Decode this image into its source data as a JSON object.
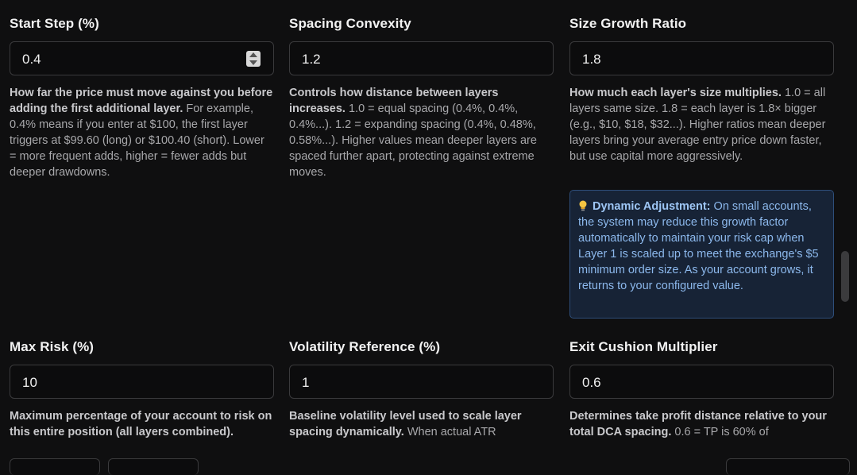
{
  "fields": [
    {
      "label": "Start Step (%)",
      "value": "0.4",
      "desc_bold": "How far the price must move against you before adding the first additional layer.",
      "desc_rest": " For example, 0.4% means if you enter at $100, the first layer triggers at $99.60 (long) or $100.40 (short). Lower = more frequent adds, higher = fewer adds but deeper drawdowns."
    },
    {
      "label": "Spacing Convexity",
      "value": "1.2",
      "desc_bold": "Controls how distance between layers increases.",
      "desc_rest": " 1.0 = equal spacing (0.4%, 0.4%, 0.4%...). 1.2 = expanding spacing (0.4%, 0.48%, 0.58%...). Higher values mean deeper layers are spaced further apart, protecting against extreme moves."
    },
    {
      "label": "Size Growth Ratio",
      "value": "1.8",
      "desc_bold": "How much each layer's size multiplies.",
      "desc_rest": " 1.0 = all layers same size. 1.8 = each layer is 1.8× bigger (e.g., $10, $18, $32...). Higher ratios mean deeper layers bring your average entry price down faster, but use capital more aggressively."
    },
    {
      "label": "Max Risk (%)",
      "value": "10",
      "desc_bold": "Maximum percentage of your account to risk on this entire position (all layers combined).",
      "desc_rest": ""
    },
    {
      "label": "Volatility Reference (%)",
      "value": "1",
      "desc_bold": "Baseline volatility level used to scale layer spacing dynamically.",
      "desc_rest": " When actual ATR"
    },
    {
      "label": "Exit Cushion Multiplier",
      "value": "0.6",
      "desc_bold": "Determines take profit distance relative to your total DCA spacing.",
      "desc_rest": " 0.6 = TP is 60% of"
    }
  ],
  "notice": {
    "icon": "lightbulb-icon",
    "title": "Dynamic Adjustment:",
    "text": " On small accounts, the system may reduce this growth factor automatically to maintain your risk cap when Layer 1 is scaled up to meet the exchange's $5 minimum order size. As your account grows, it returns to your configured value."
  },
  "colors": {
    "background": "#0f0f10",
    "notice_bg": "#172336",
    "notice_text": "#8cb8ec"
  }
}
